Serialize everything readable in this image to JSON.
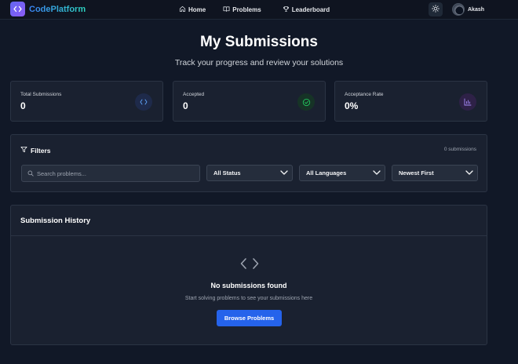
{
  "nav": {
    "brand": "CodePlatform",
    "links": [
      "Home",
      "Problems",
      "Leaderboard"
    ],
    "user_name": "Akash"
  },
  "header": {
    "title": "My Submissions",
    "subtitle": "Track your progress and review your solutions"
  },
  "stats": [
    {
      "label": "Total Submissions",
      "value": "0",
      "icon": "code-icon",
      "color": "#60a5fa"
    },
    {
      "label": "Accepted",
      "value": "0",
      "icon": "check-circle-icon",
      "color": "#22c55e"
    },
    {
      "label": "Acceptance Rate",
      "value": "0%",
      "icon": "bar-chart-icon",
      "color": "#a78bfa"
    }
  ],
  "filters": {
    "title": "Filters",
    "count": "0 submissions",
    "search_placeholder": "Search problems...",
    "status": "All Status",
    "language": "All Languages",
    "sort": "Newest First"
  },
  "history": {
    "title": "Submission History",
    "empty_title": "No submissions found",
    "empty_subtitle": "Start solving problems to see your submissions here",
    "button": "Browse Problems"
  },
  "colors": {
    "background": "#111827",
    "card": "#1a2130",
    "accent": "#2563eb"
  }
}
